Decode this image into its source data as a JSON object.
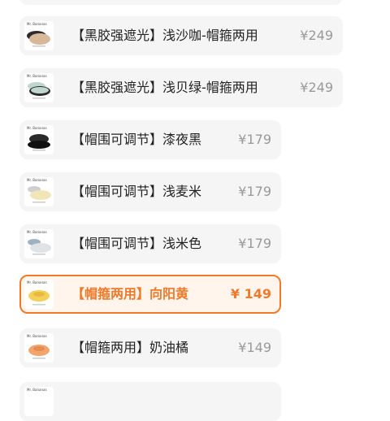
{
  "options": [
    {
      "title": "【黑胶强遮光】浅沙咖-帽箍两用",
      "price": "¥249",
      "selected": false,
      "color_name": "浅沙咖",
      "swatch": "#d9b89a"
    },
    {
      "title": "【黑胶强遮光】浅贝绿-帽箍两用",
      "price": "¥249",
      "selected": false,
      "color_name": "浅贝绿",
      "swatch": "#bfd6cf"
    },
    {
      "title": "【帽围可调节】漆夜黑",
      "price": "¥179",
      "selected": false,
      "color_name": "漆夜黑",
      "swatch": "#2a2a2a"
    },
    {
      "title": "【帽围可调节】浅麦米",
      "price": "¥179",
      "selected": false,
      "color_name": "浅麦米",
      "swatch": "#f0e6b8"
    },
    {
      "title": "【帽围可调节】浅米色",
      "price": "¥179",
      "selected": false,
      "color_name": "浅米色",
      "swatch": "#dfe3e6"
    },
    {
      "title": "【帽箍两用】向阳黄",
      "price": "¥ 149",
      "selected": true,
      "color_name": "向阳黄",
      "swatch": "#f4cf5a"
    },
    {
      "title": "【帽箍两用】奶油橘",
      "price": "¥149",
      "selected": false,
      "color_name": "奶油橘",
      "swatch": "#f2a56e"
    }
  ],
  "thumb_brand": "Mr. Bananas",
  "colors": {
    "accent": "#f07a2a",
    "card_bg": "#f5f5f5",
    "selected_bg": "#fff5ec",
    "price_gray": "#999999"
  }
}
